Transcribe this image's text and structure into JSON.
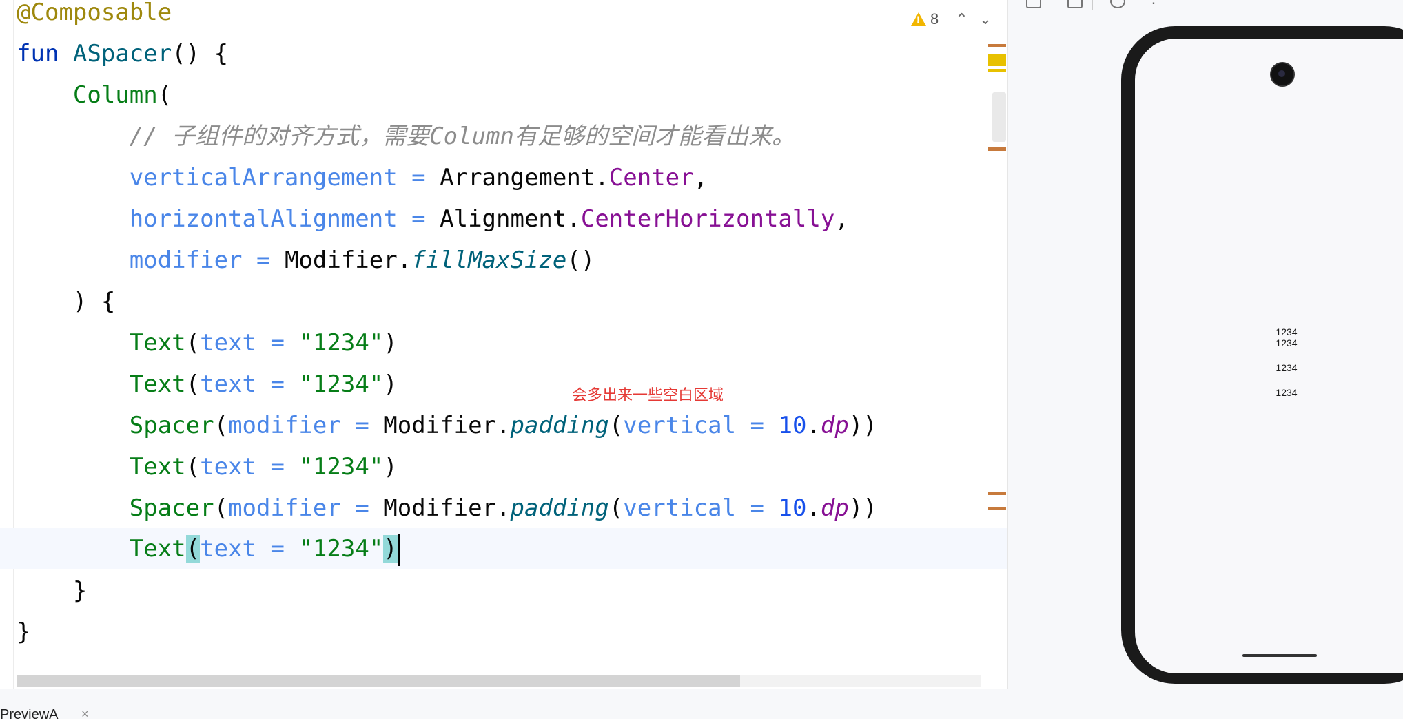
{
  "editor": {
    "inspection": {
      "warning_count": "8"
    },
    "comment_text": "// 子组件的对齐方式，需要Column有足够的空间才能看出来。",
    "annotation_note": "会多出来一些空白区域",
    "tokens": {
      "annotation": "@Composable",
      "fun_kw": "fun",
      "fn_name": "ASpacer",
      "column": "Column",
      "vertical_arrangement": "verticalArrangement",
      "horizontal_alignment": "horizontalAlignment",
      "modifier": "modifier",
      "arrangement": "Arrangement",
      "center": "Center",
      "alignment": "Alignment",
      "center_horizontally": "CenterHorizontally",
      "modifier_obj": "Modifier",
      "fill_max_size": "fillMaxSize",
      "text_fn": "Text",
      "text_param": "text",
      "text_value": "\"1234\"",
      "spacer": "Spacer",
      "padding": "padding",
      "vertical": "vertical",
      "ten": "10",
      "dp": "dp"
    }
  },
  "preview": {
    "lines": [
      "1234",
      "1234",
      "1234",
      "1234"
    ]
  },
  "bottom_tab": {
    "label": "PreviewA",
    "close": "×"
  },
  "colors": {
    "keyword": "#0033b3",
    "annotation": "#9e880d",
    "string": "#067d17",
    "param": "#4a86e8",
    "number": "#1750eb",
    "property": "#871094",
    "comment": "#8c8c8c",
    "note": "#e53935"
  }
}
